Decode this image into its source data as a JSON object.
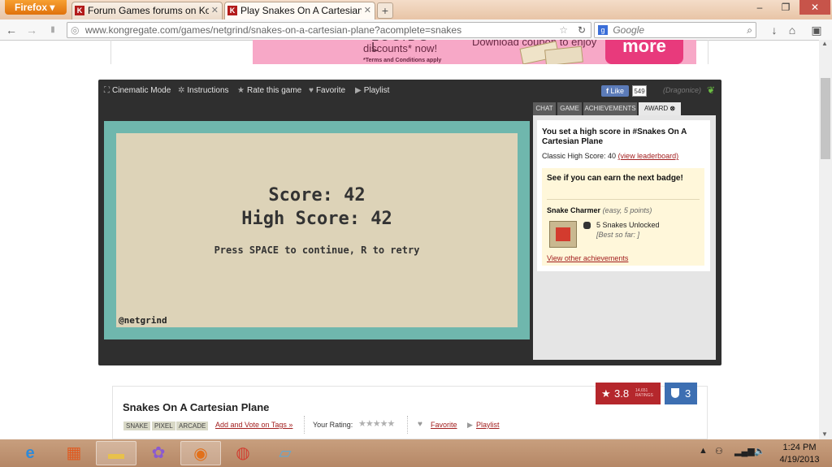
{
  "browser": {
    "app_button": "Firefox",
    "tabs": [
      {
        "title": "Forum Games forums on Kon...",
        "favicon": "kongregate-k-icon"
      },
      {
        "title": "Play Snakes On A Cartesian Pl...",
        "favicon": "kongregate-k-icon"
      }
    ],
    "new_tab": "+",
    "url": "www.kongregate.com/games/netgrind/snakes-on-a-cartesian-plane?acomplete=snakes",
    "search_placeholder": "Google",
    "window_buttons": {
      "minimize": "–",
      "restore": "❐",
      "close": "✕"
    }
  },
  "ad": {
    "line1": "LUCIDO-L",
    "line2": "Download coupon to enjoy",
    "line3": "discounts* now!",
    "terms": "*Terms and Conditions apply",
    "button": "more"
  },
  "game_toolbar": {
    "cinematic": "Cinematic Mode",
    "instructions": "Instructions",
    "rate": "Rate this game",
    "favorite": "Favorite",
    "playlist": "Playlist",
    "fb_like": "Like",
    "fb_count": "549",
    "username": "(Dragonice)"
  },
  "right_tabs": [
    "CHAT",
    "GAME",
    "ACHIEVEMENTS",
    "AWARD"
  ],
  "game": {
    "score": "Score: 42",
    "high_score": "High Score: 42",
    "prompt": "Press SPACE to continue, R to retry",
    "credit": "@netgrind"
  },
  "award": {
    "title": "You set a high score in #Snakes On A Cartesian Plane",
    "score_label": "Classic High Score: 40",
    "leaderboard_link": "(view leaderboard)",
    "earn_heading": "See if you can earn the next badge!",
    "badge_name": "Snake Charmer",
    "badge_meta": "(easy, 5 points)",
    "badge_requirement": "5 Snakes Unlocked",
    "best_so_far": "[Best so far: ]",
    "view_other": "View other achievements"
  },
  "game_info": {
    "title": "Snakes On A Cartesian Plane",
    "tags": [
      "SNAKE",
      "PIXEL",
      "ARCADE"
    ],
    "tags_link": "Add and Vote on Tags »",
    "your_rating": "Your Rating:",
    "stars": "★★★★★",
    "favorite": "Favorite",
    "playlist": "Playlist",
    "rating": "3.8",
    "rating_count": "14,651",
    "rating_word": "RATINGS",
    "badges": "3"
  },
  "taskbar": {
    "time": "1:24 PM",
    "date": "4/19/2013"
  }
}
